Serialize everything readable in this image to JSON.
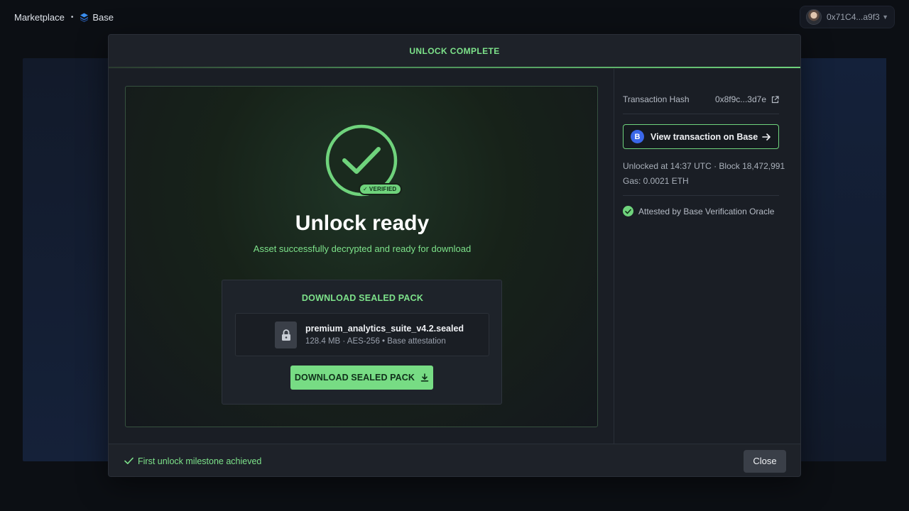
{
  "topbar": {
    "breadcrumb_marketplace": "Marketplace",
    "breadcrumb_separator": "•",
    "breadcrumb_network": "Base",
    "wallet_address": "0x71C4...a9f3"
  },
  "modal": {
    "header_title": "UNLOCK COMPLETE",
    "badge_label": "VERIFIED",
    "title": "Unlock ready",
    "subtitle": "Asset successfully decrypted and ready for download",
    "download": {
      "heading": "DOWNLOAD SEALED PACK",
      "file_name": "premium_analytics_suite_v4.2.sealed",
      "file_meta": "128.4 MB · AES-256 • Base attestation",
      "button_label": "DOWNLOAD SEALED PACK"
    },
    "sidebar": {
      "tx_hash_label": "Transaction Hash",
      "tx_hash_value": "0x8f9c...3d7e",
      "view_button_label": "View transaction on Base",
      "base_icon_letter": "B",
      "unlocked_line": "Unlocked at 14:37 UTC · Block 18,472,991",
      "gas_line": "Gas: 0.0021 ETH",
      "attestation": "Attested by Base Verification Oracle"
    },
    "footer": {
      "milestone": "First unlock milestone achieved",
      "close_label": "Close"
    }
  },
  "colors": {
    "accent_green": "#6fd37c",
    "base_blue": "#3a67e8",
    "background": "#0c0f14"
  }
}
